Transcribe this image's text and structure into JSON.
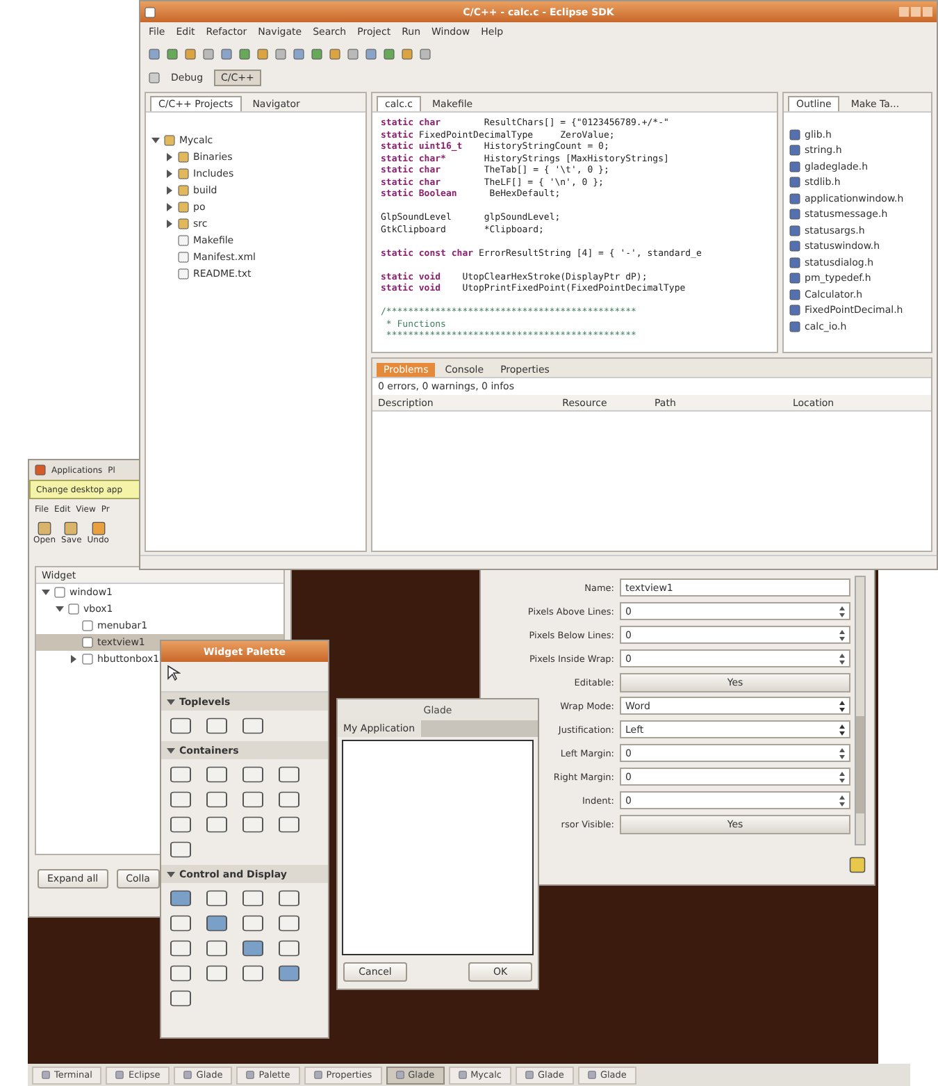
{
  "eclipse": {
    "title": "C/C++ - calc.c - Eclipse SDK",
    "menu": [
      "File",
      "Edit",
      "Refactor",
      "Navigate",
      "Search",
      "Project",
      "Run",
      "Window",
      "Help"
    ],
    "perspectives": [
      {
        "label": "Debug",
        "selected": false
      },
      {
        "label": "C/C++",
        "selected": true
      }
    ],
    "left_tabs": [
      {
        "label": "C/C++ Projects",
        "selected": true
      },
      {
        "label": "Navigator",
        "selected": false
      }
    ],
    "tree": [
      {
        "label": "Mycalc",
        "expanded": true,
        "children": [
          {
            "label": "Binaries",
            "expanded": false
          },
          {
            "label": "Includes",
            "expanded": false
          },
          {
            "label": "build",
            "expanded": false
          },
          {
            "label": "po",
            "expanded": false
          },
          {
            "label": "src",
            "expanded": false
          },
          {
            "label": "Makefile"
          },
          {
            "label": "Manifest.xml"
          },
          {
            "label": "README.txt"
          }
        ]
      }
    ],
    "editor_tabs": [
      {
        "label": "calc.c",
        "selected": true
      },
      {
        "label": "Makefile",
        "selected": false
      }
    ],
    "code": [
      {
        "kind": "decl",
        "keyword": "static char",
        "rest": "        ResultChars[] = {\"0123456789.+/*-\""
      },
      {
        "kind": "decl",
        "keyword": "static",
        "rest": " FixedPointDecimalType     ZeroValue;"
      },
      {
        "kind": "decl",
        "keyword": "static uint16_t",
        "rest": "    HistoryStringCount = 0;"
      },
      {
        "kind": "decl",
        "keyword": "static char*",
        "rest": "       HistoryStrings [MaxHistoryStrings]"
      },
      {
        "kind": "decl",
        "keyword": "static char",
        "rest": "        TheTab[] = { '\\t', 0 };"
      },
      {
        "kind": "decl",
        "keyword": "static char",
        "rest": "        TheLF[] = { '\\n', 0 };"
      },
      {
        "kind": "decl",
        "keyword": "static Boolean",
        "rest": "      BeHexDefault;"
      },
      {
        "kind": "blank"
      },
      {
        "kind": "plain",
        "rest": "GlpSoundLevel      glpSoundLevel;"
      },
      {
        "kind": "plain",
        "rest": "GtkClipboard       *Clipboard;"
      },
      {
        "kind": "blank"
      },
      {
        "kind": "decl",
        "keyword": "static const char",
        "rest": " ErrorResultString [4] = { '-', standard_e"
      },
      {
        "kind": "blank"
      },
      {
        "kind": "decl",
        "keyword": "static void",
        "rest": "    UtopClearHexStroke(DisplayPtr dP);"
      },
      {
        "kind": "decl",
        "keyword": "static void",
        "rest": "    UtopPrintFixedPoint(FixedPointDecimalType"
      },
      {
        "kind": "blank"
      },
      {
        "kind": "comment",
        "rest": "/**********************************************"
      },
      {
        "kind": "comment",
        "rest": " * Functions"
      },
      {
        "kind": "comment",
        "rest": " **********************************************"
      }
    ],
    "outline_tabs": [
      {
        "label": "Outline",
        "selected": true
      },
      {
        "label": "Make Ta...",
        "selected": false
      }
    ],
    "outline": [
      "glib.h",
      "string.h",
      "gladeglade.h",
      "stdlib.h",
      "applicationwindow.h",
      "statusmessage.h",
      "statusargs.h",
      "statuswindow.h",
      "statusdialog.h",
      "pm_typedef.h",
      "Calculator.h",
      "FixedPointDecimal.h",
      "calc_io.h"
    ],
    "bottom_tabs": [
      {
        "label": "Problems",
        "selected": true
      },
      {
        "label": "Console",
        "selected": false
      },
      {
        "label": "Properties",
        "selected": false
      }
    ],
    "problems_summary": "0 errors, 0 warnings, 0 infos",
    "problems_columns": [
      "Description",
      "Resource",
      "Path",
      "Location"
    ]
  },
  "glade": {
    "panel_menu": [
      "Applications",
      "Pl"
    ],
    "tooltip": "Change desktop app",
    "menu": [
      "File",
      "Edit",
      "View",
      "Pr"
    ],
    "toolbar": [
      "Open",
      "Save",
      "Undo"
    ],
    "tree_header": "Widget",
    "tree": [
      {
        "label": "window1",
        "expanded": true,
        "selected": false,
        "children": [
          {
            "label": "vbox1",
            "expanded": true,
            "selected": false,
            "children": [
              {
                "label": "menubar1",
                "selected": false
              },
              {
                "label": "textview1",
                "selected": true
              },
              {
                "label": "hbuttonbox1",
                "expanded": false,
                "selected": false
              }
            ]
          }
        ]
      }
    ],
    "buttons": [
      "Expand all",
      "Colla"
    ]
  },
  "palette": {
    "title": "Widget Palette",
    "sections": [
      {
        "label": "Toplevels",
        "expanded": true
      },
      {
        "label": "Containers",
        "expanded": true
      },
      {
        "label": "Control and Display",
        "expanded": true
      }
    ]
  },
  "dialog": {
    "title": "Glade",
    "header": "My Application",
    "buttons": [
      "Cancel",
      "OK"
    ]
  },
  "properties": {
    "rows": [
      {
        "kind": "text",
        "label": "Name:",
        "value": "textview1"
      },
      {
        "kind": "spin",
        "label": "Pixels Above Lines:",
        "value": "0"
      },
      {
        "kind": "spin",
        "label": "Pixels Below Lines:",
        "value": "0"
      },
      {
        "kind": "spin",
        "label": "Pixels Inside Wrap:",
        "value": "0"
      },
      {
        "kind": "toggle",
        "label": "Editable:",
        "value": "Yes"
      },
      {
        "kind": "combo",
        "label": "Wrap Mode:",
        "value": "Word"
      },
      {
        "kind": "combo",
        "label": "Justification:",
        "value": "Left"
      },
      {
        "kind": "spin",
        "label": "Left Margin:",
        "value": "0"
      },
      {
        "kind": "spin",
        "label": "Right Margin:",
        "value": "0"
      },
      {
        "kind": "spin",
        "label": "Indent:",
        "value": "0"
      },
      {
        "kind": "toggle",
        "label": "rsor Visible:",
        "value": "Yes"
      }
    ]
  },
  "taskbar": [
    {
      "label": "Terminal",
      "selected": false
    },
    {
      "label": "Eclipse",
      "selected": false
    },
    {
      "label": "Glade",
      "selected": false
    },
    {
      "label": "Palette",
      "selected": false
    },
    {
      "label": "Properties",
      "selected": false
    },
    {
      "label": "Glade",
      "selected": true
    },
    {
      "label": "Mycalc",
      "selected": false
    },
    {
      "label": "Glade",
      "selected": false
    },
    {
      "label": "Glade",
      "selected": false
    }
  ]
}
